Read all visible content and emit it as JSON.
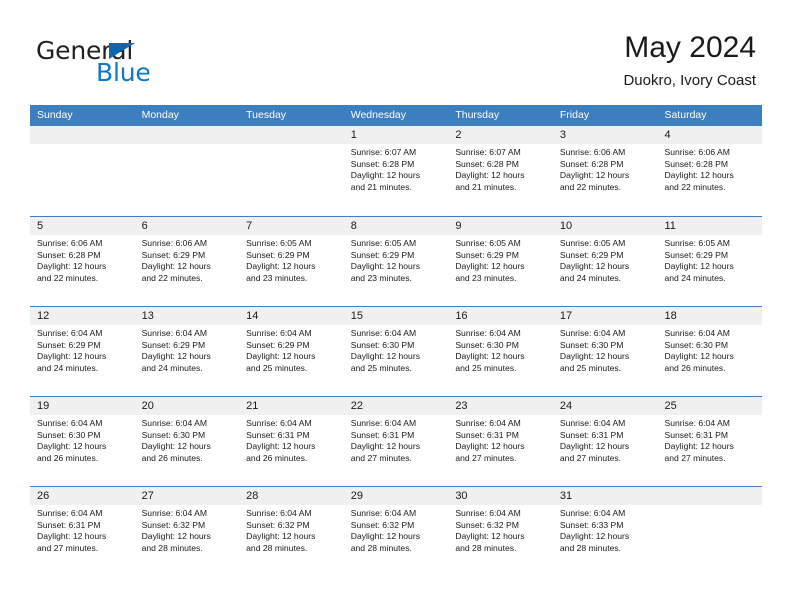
{
  "brand": {
    "name_part1": "General",
    "name_part2": "Blue",
    "triangle_color": "#0c66b1",
    "blue_color": "#1277c4"
  },
  "header": {
    "title": "May 2024",
    "subtitle": "Duokro, Ivory Coast"
  },
  "colors": {
    "header_band": "#3d7ebf",
    "day_band": "#f0f0f0",
    "text": "#1a1a1a",
    "grid_line": "#3d7ebf"
  },
  "calendar": {
    "weekdays": [
      "Sunday",
      "Monday",
      "Tuesday",
      "Wednesday",
      "Thursday",
      "Friday",
      "Saturday"
    ],
    "weeks": [
      [
        {
          "day": "",
          "sunrise": "",
          "sunset": "",
          "daylight_line1": "",
          "daylight_line2": ""
        },
        {
          "day": "",
          "sunrise": "",
          "sunset": "",
          "daylight_line1": "",
          "daylight_line2": ""
        },
        {
          "day": "",
          "sunrise": "",
          "sunset": "",
          "daylight_line1": "",
          "daylight_line2": ""
        },
        {
          "day": "1",
          "sunrise": "Sunrise: 6:07 AM",
          "sunset": "Sunset: 6:28 PM",
          "daylight_line1": "Daylight: 12 hours",
          "daylight_line2": "and 21 minutes."
        },
        {
          "day": "2",
          "sunrise": "Sunrise: 6:07 AM",
          "sunset": "Sunset: 6:28 PM",
          "daylight_line1": "Daylight: 12 hours",
          "daylight_line2": "and 21 minutes."
        },
        {
          "day": "3",
          "sunrise": "Sunrise: 6:06 AM",
          "sunset": "Sunset: 6:28 PM",
          "daylight_line1": "Daylight: 12 hours",
          "daylight_line2": "and 22 minutes."
        },
        {
          "day": "4",
          "sunrise": "Sunrise: 6:06 AM",
          "sunset": "Sunset: 6:28 PM",
          "daylight_line1": "Daylight: 12 hours",
          "daylight_line2": "and 22 minutes."
        }
      ],
      [
        {
          "day": "5",
          "sunrise": "Sunrise: 6:06 AM",
          "sunset": "Sunset: 6:28 PM",
          "daylight_line1": "Daylight: 12 hours",
          "daylight_line2": "and 22 minutes."
        },
        {
          "day": "6",
          "sunrise": "Sunrise: 6:06 AM",
          "sunset": "Sunset: 6:29 PM",
          "daylight_line1": "Daylight: 12 hours",
          "daylight_line2": "and 22 minutes."
        },
        {
          "day": "7",
          "sunrise": "Sunrise: 6:05 AM",
          "sunset": "Sunset: 6:29 PM",
          "daylight_line1": "Daylight: 12 hours",
          "daylight_line2": "and 23 minutes."
        },
        {
          "day": "8",
          "sunrise": "Sunrise: 6:05 AM",
          "sunset": "Sunset: 6:29 PM",
          "daylight_line1": "Daylight: 12 hours",
          "daylight_line2": "and 23 minutes."
        },
        {
          "day": "9",
          "sunrise": "Sunrise: 6:05 AM",
          "sunset": "Sunset: 6:29 PM",
          "daylight_line1": "Daylight: 12 hours",
          "daylight_line2": "and 23 minutes."
        },
        {
          "day": "10",
          "sunrise": "Sunrise: 6:05 AM",
          "sunset": "Sunset: 6:29 PM",
          "daylight_line1": "Daylight: 12 hours",
          "daylight_line2": "and 24 minutes."
        },
        {
          "day": "11",
          "sunrise": "Sunrise: 6:05 AM",
          "sunset": "Sunset: 6:29 PM",
          "daylight_line1": "Daylight: 12 hours",
          "daylight_line2": "and 24 minutes."
        }
      ],
      [
        {
          "day": "12",
          "sunrise": "Sunrise: 6:04 AM",
          "sunset": "Sunset: 6:29 PM",
          "daylight_line1": "Daylight: 12 hours",
          "daylight_line2": "and 24 minutes."
        },
        {
          "day": "13",
          "sunrise": "Sunrise: 6:04 AM",
          "sunset": "Sunset: 6:29 PM",
          "daylight_line1": "Daylight: 12 hours",
          "daylight_line2": "and 24 minutes."
        },
        {
          "day": "14",
          "sunrise": "Sunrise: 6:04 AM",
          "sunset": "Sunset: 6:29 PM",
          "daylight_line1": "Daylight: 12 hours",
          "daylight_line2": "and 25 minutes."
        },
        {
          "day": "15",
          "sunrise": "Sunrise: 6:04 AM",
          "sunset": "Sunset: 6:30 PM",
          "daylight_line1": "Daylight: 12 hours",
          "daylight_line2": "and 25 minutes."
        },
        {
          "day": "16",
          "sunrise": "Sunrise: 6:04 AM",
          "sunset": "Sunset: 6:30 PM",
          "daylight_line1": "Daylight: 12 hours",
          "daylight_line2": "and 25 minutes."
        },
        {
          "day": "17",
          "sunrise": "Sunrise: 6:04 AM",
          "sunset": "Sunset: 6:30 PM",
          "daylight_line1": "Daylight: 12 hours",
          "daylight_line2": "and 25 minutes."
        },
        {
          "day": "18",
          "sunrise": "Sunrise: 6:04 AM",
          "sunset": "Sunset: 6:30 PM",
          "daylight_line1": "Daylight: 12 hours",
          "daylight_line2": "and 26 minutes."
        }
      ],
      [
        {
          "day": "19",
          "sunrise": "Sunrise: 6:04 AM",
          "sunset": "Sunset: 6:30 PM",
          "daylight_line1": "Daylight: 12 hours",
          "daylight_line2": "and 26 minutes."
        },
        {
          "day": "20",
          "sunrise": "Sunrise: 6:04 AM",
          "sunset": "Sunset: 6:30 PM",
          "daylight_line1": "Daylight: 12 hours",
          "daylight_line2": "and 26 minutes."
        },
        {
          "day": "21",
          "sunrise": "Sunrise: 6:04 AM",
          "sunset": "Sunset: 6:31 PM",
          "daylight_line1": "Daylight: 12 hours",
          "daylight_line2": "and 26 minutes."
        },
        {
          "day": "22",
          "sunrise": "Sunrise: 6:04 AM",
          "sunset": "Sunset: 6:31 PM",
          "daylight_line1": "Daylight: 12 hours",
          "daylight_line2": "and 27 minutes."
        },
        {
          "day": "23",
          "sunrise": "Sunrise: 6:04 AM",
          "sunset": "Sunset: 6:31 PM",
          "daylight_line1": "Daylight: 12 hours",
          "daylight_line2": "and 27 minutes."
        },
        {
          "day": "24",
          "sunrise": "Sunrise: 6:04 AM",
          "sunset": "Sunset: 6:31 PM",
          "daylight_line1": "Daylight: 12 hours",
          "daylight_line2": "and 27 minutes."
        },
        {
          "day": "25",
          "sunrise": "Sunrise: 6:04 AM",
          "sunset": "Sunset: 6:31 PM",
          "daylight_line1": "Daylight: 12 hours",
          "daylight_line2": "and 27 minutes."
        }
      ],
      [
        {
          "day": "26",
          "sunrise": "Sunrise: 6:04 AM",
          "sunset": "Sunset: 6:31 PM",
          "daylight_line1": "Daylight: 12 hours",
          "daylight_line2": "and 27 minutes."
        },
        {
          "day": "27",
          "sunrise": "Sunrise: 6:04 AM",
          "sunset": "Sunset: 6:32 PM",
          "daylight_line1": "Daylight: 12 hours",
          "daylight_line2": "and 28 minutes."
        },
        {
          "day": "28",
          "sunrise": "Sunrise: 6:04 AM",
          "sunset": "Sunset: 6:32 PM",
          "daylight_line1": "Daylight: 12 hours",
          "daylight_line2": "and 28 minutes."
        },
        {
          "day": "29",
          "sunrise": "Sunrise: 6:04 AM",
          "sunset": "Sunset: 6:32 PM",
          "daylight_line1": "Daylight: 12 hours",
          "daylight_line2": "and 28 minutes."
        },
        {
          "day": "30",
          "sunrise": "Sunrise: 6:04 AM",
          "sunset": "Sunset: 6:32 PM",
          "daylight_line1": "Daylight: 12 hours",
          "daylight_line2": "and 28 minutes."
        },
        {
          "day": "31",
          "sunrise": "Sunrise: 6:04 AM",
          "sunset": "Sunset: 6:33 PM",
          "daylight_line1": "Daylight: 12 hours",
          "daylight_line2": "and 28 minutes."
        },
        {
          "day": "",
          "sunrise": "",
          "sunset": "",
          "daylight_line1": "",
          "daylight_line2": ""
        }
      ]
    ]
  }
}
